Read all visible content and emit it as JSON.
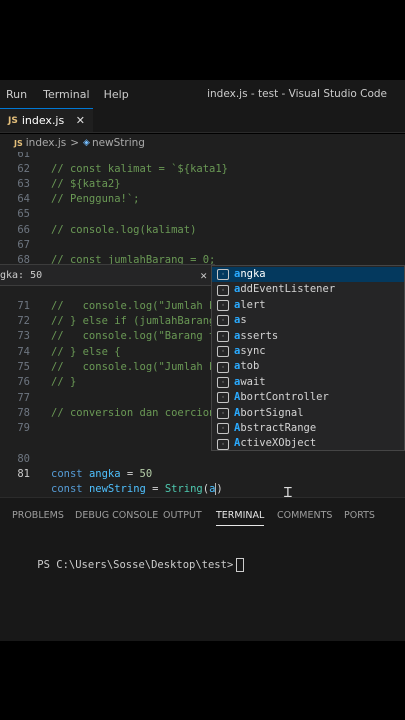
{
  "menu": {
    "items": [
      "Run",
      "Terminal",
      "Help"
    ],
    "window_title": "index.js - test - Visual Studio Code"
  },
  "tab": {
    "badge": "JS",
    "label": "index.js",
    "close": "✕"
  },
  "breadcrumb": {
    "badge": "JS",
    "file": "index.js",
    "separator": ">",
    "symbol_icon": "◈",
    "symbol": "newString"
  },
  "editor": {
    "lines": [
      {
        "n": "61",
        "code": ""
      },
      {
        "n": "62",
        "code": "// const kalimat = `${kata1}"
      },
      {
        "n": "63",
        "code": "// ${kata2}"
      },
      {
        "n": "64",
        "code": "// Pengguna!`;"
      },
      {
        "n": "65",
        "code": ""
      },
      {
        "n": "66",
        "code": "// console.log(kalimat)"
      },
      {
        "n": "67",
        "code": ""
      },
      {
        "n": "68",
        "code": "// const jumlahBarang = 0;"
      },
      {
        "n": "71",
        "code": "//   console.log(\"Jumlah b"
      },
      {
        "n": "72",
        "code": "// } else if (jumlahBarang"
      },
      {
        "n": "73",
        "code": "//   console.log(\"Barang t"
      },
      {
        "n": "74",
        "code": "// } else {"
      },
      {
        "n": "75",
        "code": "//   console.log(\"Jumlah b"
      },
      {
        "n": "76",
        "code": "// }"
      },
      {
        "n": "77",
        "code": ""
      },
      {
        "n": "78",
        "code": "// conversion dan coercion"
      },
      {
        "n": "79",
        "code": ""
      },
      {
        "n": "80",
        "code": "const angka = 50"
      },
      {
        "n": "81",
        "code": "const newString = String(a"
      }
    ],
    "line80": {
      "kw": "const",
      "var": "angka",
      "op": " = ",
      "num": "50"
    },
    "line81": {
      "kw": "const",
      "var": "newString",
      "op": " = ",
      "fn": "String",
      "paren": "(",
      "typed": "a"
    }
  },
  "hover": {
    "text": "gka: 50",
    "close": "✕"
  },
  "suggestions": {
    "items": [
      "angka",
      "addEventListener",
      "alert",
      "as",
      "asserts",
      "async",
      "atob",
      "await",
      "AbortController",
      "AbortSignal",
      "AbstractRange",
      "ActiveXObject"
    ],
    "selected_index": 0
  },
  "panel": {
    "tabs": [
      "PROBLEMS",
      "DEBUG CONSOLE",
      "OUTPUT",
      "TERMINAL",
      "COMMENTS",
      "PORTS"
    ],
    "active_tab": "TERMINAL",
    "prompt": "PS C:\\Users\\Sosse\\Desktop\\test>"
  },
  "colors": {
    "accent": "#0078d4",
    "selection": "#04395e",
    "comment": "#6a9955",
    "keyword": "#569cd6"
  }
}
